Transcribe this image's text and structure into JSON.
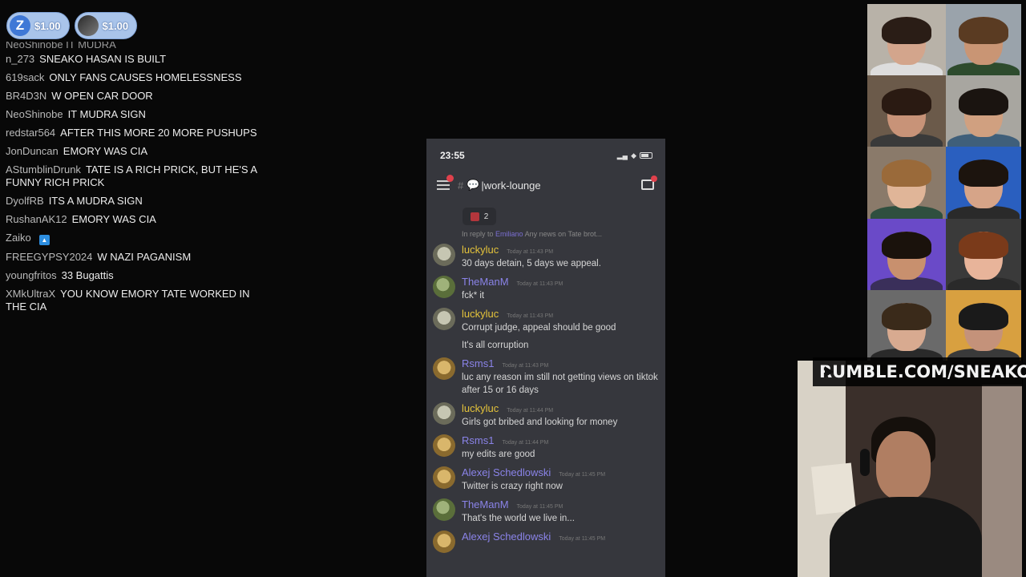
{
  "tips": [
    {
      "avatar_letter": "Z",
      "amount": "$1.00"
    },
    {
      "avatar_letter": "",
      "amount": "$1.00"
    }
  ],
  "chat": {
    "cut_line": "NeoShinobe  IT MUDRA",
    "messages": [
      {
        "user": "n_273",
        "text": "SNEAKO HASAN IS BUILT"
      },
      {
        "user": "619sack",
        "text": "ONLY FANS CAUSES HOMELESSNESS"
      },
      {
        "user": "BR4D3N",
        "text": "W OPEN CAR DOOR"
      },
      {
        "user": "NeoShinobe",
        "text": "IT MUDRA SIGN"
      },
      {
        "user": "redstar564",
        "text": "AFTER THIS MORE 20 MORE PUSHUPS"
      },
      {
        "user": "JonDuncan",
        "text": "EMORY WAS CIA"
      },
      {
        "user": "AStumblinDrunk",
        "text": "TATE IS A RICH PRICK, BUT HE'S A FUNNY RICH PRICK"
      },
      {
        "user": "DyolfRB",
        "text": "ITS A MUDRA SIGN"
      },
      {
        "user": "RushanAK12",
        "text": "EMORY WAS CIA"
      },
      {
        "user": "Zaiko",
        "text": ""
      },
      {
        "user": "FREEGYPSY2024",
        "text": "W NAZI PAGANISM"
      },
      {
        "user": "youngfritos",
        "text": "33 Bugattis"
      },
      {
        "user": "XMkUltraX",
        "text": "YOU KNOW EMORY TATE WORKED IN THE CIA"
      }
    ]
  },
  "phone": {
    "clock": "23:55",
    "channel": "|work-lounge",
    "reaction_count": "2",
    "reply_prefix": "In reply to",
    "reply_user": "Emiliano",
    "reply_text": "Any news on Tate brot...",
    "messages": [
      {
        "user": "luckyluc",
        "color": "gold",
        "avatar": "grey",
        "time": "Today at 11:43 PM",
        "lines": [
          "30 days detain, 5 days we appeal."
        ]
      },
      {
        "user": "TheManM",
        "color": "purple",
        "avatar": "pepe",
        "time": "Today at 11:43 PM",
        "lines": [
          "fck* it"
        ]
      },
      {
        "user": "luckyluc",
        "color": "gold",
        "avatar": "grey",
        "time": "Today at 11:43 PM",
        "lines": [
          "Corrupt judge, appeal should be good",
          "It's all corruption"
        ]
      },
      {
        "user": "Rsms1",
        "color": "purple",
        "avatar": "bear",
        "time": "Today at 11:43 PM",
        "lines": [
          "luc any reason im still not getting views on tiktok after 15 or 16 days"
        ]
      },
      {
        "user": "luckyluc",
        "color": "gold",
        "avatar": "grey",
        "time": "Today at 11:44 PM",
        "lines": [
          "Girls got bribed and looking for money"
        ]
      },
      {
        "user": "Rsms1",
        "color": "purple",
        "avatar": "bear",
        "time": "Today at 11:44 PM",
        "lines": [
          "my edits are good"
        ]
      },
      {
        "user": "Alexej Schedlowski",
        "color": "purple",
        "avatar": "bear",
        "time": "Today at 11:45 PM",
        "lines": [
          "Twitter is crazy right now"
        ]
      },
      {
        "user": "TheManM",
        "color": "purple",
        "avatar": "pepe",
        "time": "Today at 11:45 PM",
        "lines": [
          "That's the world we live in..."
        ]
      },
      {
        "user": "Alexej Schedlowski",
        "color": "purple",
        "avatar": "bear",
        "time": "Today at 11:45 PM",
        "lines": [
          ""
        ]
      }
    ]
  },
  "cams": [
    {
      "bg": "#b8b2a8",
      "hair": "#2a1d16",
      "skin": "#d3a58c",
      "shirt": "#ddd"
    },
    {
      "bg": "#9aa3ab",
      "hair": "#5a3b22",
      "skin": "#c99574",
      "shirt": "#2d4b2d"
    },
    {
      "bg": "#6b5a4a",
      "hair": "#2a1a12",
      "skin": "#c89378",
      "shirt": "#3a3a3a"
    },
    {
      "bg": "#a8a6a0",
      "hair": "#1a1410",
      "skin": "#d0a080",
      "shirt": "#3f5f7a"
    },
    {
      "bg": "#8a7a6a",
      "hair": "#9a6a3a",
      "skin": "#e0b598",
      "shirt": "#2f4f3f"
    },
    {
      "bg": "#2a5fbf",
      "hair": "#1c140e",
      "skin": "#d6a488",
      "shirt": "#2a2a2a"
    },
    {
      "bg": "#6a4ac8",
      "hair": "#1a120c",
      "skin": "#c8906e",
      "shirt": "#3a2f5a"
    },
    {
      "bg": "#3a3a3a",
      "hair": "#7a3a1a",
      "skin": "#e8b49a",
      "shirt": "#2a2a2a"
    },
    {
      "bg": "#6a6a6a",
      "hair": "#3a2a1a",
      "skin": "#d8aa90",
      "shirt": "#2a2a2a"
    },
    {
      "bg": "#d8a040",
      "hair": "#1a1a1a",
      "skin": "#c4927a",
      "shirt": "#3a3a3a"
    }
  ],
  "rumble": "RUMBLE.COM/SNEAKO"
}
